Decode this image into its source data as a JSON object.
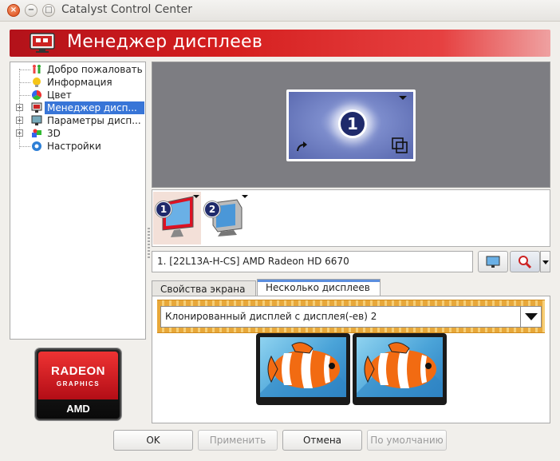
{
  "window": {
    "title": "Catalyst Control Center",
    "close_glyph": "×",
    "minimize_glyph": "−",
    "maximize_glyph": "□"
  },
  "banner": {
    "title": "Менеджер дисплеев",
    "icon": "display-manager-icon",
    "gradient_start": "#b3121a",
    "gradient_end": "#efa1a1"
  },
  "sidebar": {
    "items": [
      {
        "label": "Добро пожаловать",
        "icon": "welcome-people-icon",
        "expandable": false
      },
      {
        "label": "Информация",
        "icon": "info-lightbulb-icon",
        "expandable": false
      },
      {
        "label": "Цвет",
        "icon": "color-wheel-icon",
        "expandable": false
      },
      {
        "label": "Менеджер дисп...",
        "icon": "display-manager-icon",
        "expandable": true,
        "selected": true
      },
      {
        "label": "Параметры дисп...",
        "icon": "display-options-icon",
        "expandable": true
      },
      {
        "label": "3D",
        "icon": "3d-cubes-icon",
        "expandable": true
      },
      {
        "label": "Настройки",
        "icon": "preferences-gear-icon",
        "expandable": false
      }
    ]
  },
  "logo": {
    "brand": "RADEON",
    "sub": "GRAPHICS",
    "maker": "AMD"
  },
  "canvas": {
    "display_number": "1"
  },
  "strip": {
    "monitors": [
      {
        "badge": "1",
        "selected": true
      },
      {
        "badge": "2",
        "selected": false
      }
    ]
  },
  "display_name": "1.  [22L13A-H-CS] AMD Radeon HD 6670",
  "tabs": [
    {
      "label": "Свойства экрана",
      "active": false
    },
    {
      "label": "Несколько дисплеев",
      "active": true
    }
  ],
  "multi": {
    "mode_value": "Клонированный дисплей с дисплея(-ев) 2"
  },
  "buttons": {
    "ok": "OK",
    "apply": "Применить",
    "cancel": "Отмена",
    "defaults": "По умолчанию"
  },
  "colors": {
    "selection": "#3875d7",
    "canvas_bg": "#7d7d82",
    "display_badge": "#1f2a6b",
    "hatch_orange": "#e8a83a"
  }
}
